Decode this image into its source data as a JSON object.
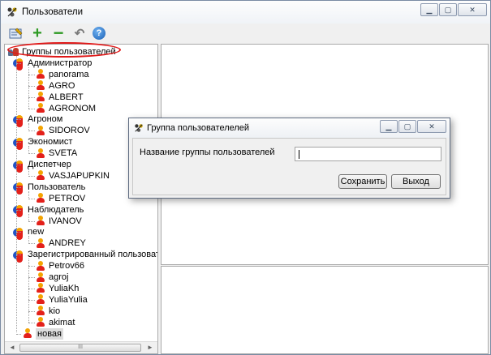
{
  "window": {
    "title": "Пользователи",
    "buttons": {
      "minimize": "▁",
      "maximize": "▢",
      "close": "✕"
    }
  },
  "toolbar": {
    "icons": [
      "edit-icon",
      "add-icon",
      "remove-icon",
      "back-icon",
      "help-icon"
    ],
    "help_label": "?",
    "add_label": "+",
    "remove_label": "−",
    "back_label": "↶"
  },
  "tree": {
    "root": "Группы пользователей",
    "groups": [
      {
        "name": "Администратор",
        "users": [
          "panorama",
          "AGRO",
          "ALBERT",
          "AGRONOM"
        ]
      },
      {
        "name": "Агроном",
        "users": [
          "SIDOROV"
        ]
      },
      {
        "name": "Экономист",
        "users": [
          "SVETA"
        ]
      },
      {
        "name": "Диспетчер",
        "users": [
          "VASJAPUPKIN"
        ]
      },
      {
        "name": "Пользователь",
        "users": [
          "PETROV"
        ]
      },
      {
        "name": "Наблюдатель",
        "users": [
          "IVANOV"
        ]
      },
      {
        "name": "new",
        "users": [
          "ANDREY"
        ]
      },
      {
        "name": "Зарегистрированный пользоват",
        "users": [
          "Petrov66",
          "agroj",
          "YuliaKh",
          "YuliaYulia",
          "kio",
          "akimat"
        ]
      }
    ],
    "last_item": "новая",
    "hscroll": {
      "left_arrow": "◄",
      "right_arrow": "►",
      "grip": "III"
    }
  },
  "dialog": {
    "title": "Группа пользователелей",
    "field_label": "Название группы пользователей",
    "field_value": "",
    "save_label": "Сохранить",
    "exit_label": "Выход",
    "buttons": {
      "minimize": "▁",
      "maximize": "▢",
      "close": "✕"
    }
  },
  "colors": {
    "annotation": "#e01818",
    "add_icon": "#2e9a24",
    "help_icon": "#1a5fb4"
  }
}
